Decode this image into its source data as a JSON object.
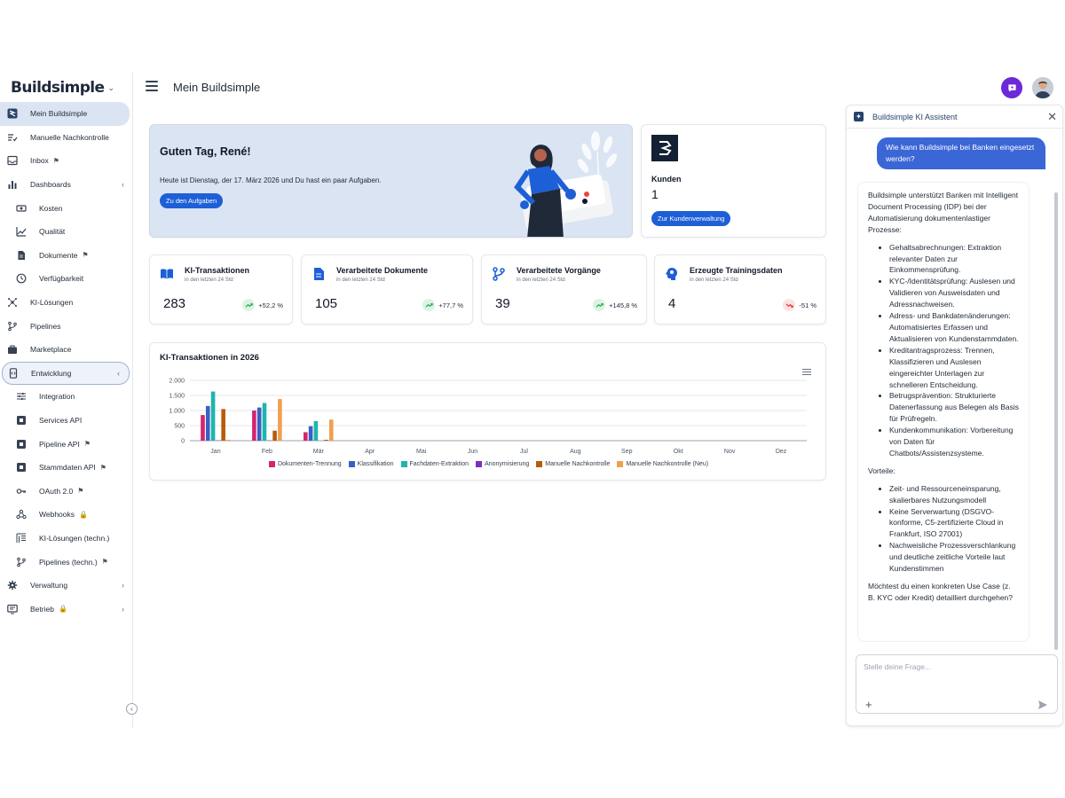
{
  "sidebar": {
    "brand": "Buildsimple",
    "items": [
      {
        "label": "Mein Buildsimple",
        "icon": "buildsimple-logo-icon"
      },
      {
        "label": "Manuelle Nachkontrolle",
        "icon": "checklist-icon"
      },
      {
        "label": "Inbox",
        "icon": "inbox-icon",
        "badge": "flag-icon"
      },
      {
        "label": "Dashboards",
        "icon": "bar-chart-icon"
      },
      {
        "label": "Kosten",
        "icon": "money-icon"
      },
      {
        "label": "Qualität",
        "icon": "trend-chart-icon"
      },
      {
        "label": "Dokumente",
        "icon": "document-icon",
        "badge": "flag-icon"
      },
      {
        "label": "Verfügbarkeit",
        "icon": "clock-icon"
      },
      {
        "label": "KI-Lösungen",
        "icon": "ai-network-icon"
      },
      {
        "label": "Pipelines",
        "icon": "branch-icon"
      },
      {
        "label": "Marketplace",
        "icon": "briefcase-icon"
      },
      {
        "label": "Entwicklung",
        "icon": "code-icon"
      },
      {
        "label": "Integration",
        "icon": "sliders-icon"
      },
      {
        "label": "Services API",
        "icon": "api-icon"
      },
      {
        "label": "Pipeline API",
        "icon": "api-icon",
        "badge": "flag-icon"
      },
      {
        "label": "Stammdaten API",
        "icon": "api-icon",
        "badge": "flag-icon"
      },
      {
        "label": "OAuth 2.0",
        "icon": "key-icon",
        "badge": "flag-icon"
      },
      {
        "label": "Webhooks",
        "icon": "webhook-icon",
        "badge": "lock-icon"
      },
      {
        "label": "KI-Lösungen (techn.)",
        "icon": "layout-icon"
      },
      {
        "label": "Pipelines (techn.)",
        "icon": "branch-icon",
        "badge": "flag-icon"
      },
      {
        "label": "Verwaltung",
        "icon": "gear-icon"
      },
      {
        "label": "Betrieb",
        "icon": "monitor-icon",
        "badge": "lock-icon"
      }
    ]
  },
  "header": {
    "title": "Mein Buildsimple"
  },
  "welcome": {
    "title": "Guten Tag, René!",
    "text": "Heute ist Dienstag, der 17. März 2026 und Du hast ein paar Aufgaben.",
    "button": "Zu den Aufgaben"
  },
  "customers": {
    "label": "Kunden",
    "value": "1",
    "button": "Zur Kundenverwaltung"
  },
  "kpis": [
    {
      "title": "KI-Transaktionen",
      "subtitle": "in den letzten 24 Std",
      "value": "283",
      "trend": "+52,2 %",
      "direction": "up",
      "icon": "book-icon"
    },
    {
      "title": "Verarbeitete Dokumente",
      "subtitle": "in den letzten 24 Std",
      "value": "105",
      "trend": "+77,7 %",
      "direction": "up",
      "icon": "document-icon"
    },
    {
      "title": "Verarbeitete Vorgänge",
      "subtitle": "in den letzten 24 Std",
      "value": "39",
      "trend": "+145,8 %",
      "direction": "up",
      "icon": "branch-icon"
    },
    {
      "title": "Erzeugte Trainingsdaten",
      "subtitle": "in den letzten 24 Std",
      "value": "4",
      "trend": "-51 %",
      "direction": "down",
      "icon": "brain-icon"
    }
  ],
  "chart_data": {
    "type": "bar",
    "title": "KI-Transaktionen in 2026",
    "categories": [
      "Jan",
      "Feb",
      "Mär",
      "Apr",
      "Mai",
      "Jun",
      "Jul",
      "Aug",
      "Sep",
      "Okt",
      "Nov",
      "Dez"
    ],
    "yticks": [
      "0",
      "500",
      "1.000",
      "1.500",
      "2.000"
    ],
    "ylim": [
      0,
      2000
    ],
    "grid": true,
    "legend_position": "bottom",
    "series": [
      {
        "name": "Dokumenten-Trennung",
        "color": "#d6246e",
        "values": [
          850,
          1000,
          280,
          0,
          0,
          0,
          0,
          0,
          0,
          0,
          0,
          0
        ]
      },
      {
        "name": "Klassifikation",
        "color": "#3b5fc4",
        "values": [
          1150,
          1100,
          480,
          0,
          0,
          0,
          0,
          0,
          0,
          0,
          0,
          0
        ]
      },
      {
        "name": "Fachdaten-Extraktion",
        "color": "#1fb5ad",
        "values": [
          1630,
          1250,
          650,
          0,
          0,
          0,
          0,
          0,
          0,
          0,
          0,
          0
        ]
      },
      {
        "name": "Anonymisierung",
        "color": "#7b2fbf",
        "values": [
          10,
          10,
          0,
          0,
          0,
          0,
          0,
          0,
          0,
          0,
          0,
          0
        ]
      },
      {
        "name": "Manuelle Nachkontrolle",
        "color": "#b85c0a",
        "values": [
          1050,
          330,
          30,
          0,
          0,
          0,
          0,
          0,
          0,
          0,
          0,
          0
        ]
      },
      {
        "name": "Manuelle Nachkontrolle (Neu)",
        "color": "#f0a050",
        "values": [
          30,
          1380,
          700,
          0,
          0,
          0,
          0,
          0,
          0,
          0,
          0,
          0
        ]
      }
    ]
  },
  "assistant": {
    "title": "Buildsimple KI Assistent",
    "user_message": "Wie kann Buildsimple bei Banken eingesetzt werden?",
    "reply_intro": "Buildsimple unterstützt Banken mit Intelligent Document Processing (IDP) bei der Automatisierung dokumentenlastiger Prozesse:",
    "reply_processes": [
      "Gehaltsabrechnungen: Extraktion relevanter Daten zur Einkommensprüfung.",
      "KYC-/Identitätsprüfung: Auslesen und Validieren von Ausweisdaten und Adressnachweisen.",
      "Adress- und Bankdatenänderungen: Automatisiertes Erfassen und Aktualisieren von Kundenstammdaten.",
      "Kreditantragsprozess: Trennen, Klassifizieren und Auslesen eingereichter Unterlagen zur schnelleren Entscheidung.",
      "Betrugsprävention: Strukturierte Datenerfassung aus Belegen als Basis für Prüfregeln.",
      "Kundenkommunikation: Vorbereitung von Daten für Chatbots/Assistenzsysteme."
    ],
    "reply_advantages_heading": "Vorteile:",
    "reply_advantages": [
      "Zeit- und Ressourceneinsparung, skalierbares Nutzungsmodell",
      "Keine Serverwartung (DSGVO-konforme, C5-zertifizierte Cloud in Frankfurt, ISO 27001)",
      "Nachweisliche Prozessverschlankung und deutliche zeitliche Vorteile laut Kundenstimmen"
    ],
    "reply_question": "Möchtest du einen konkreten Use Case (z. B. KYC oder Kredit) detailliert durchgehen?",
    "input_placeholder": "Stelle deine Frage..."
  }
}
